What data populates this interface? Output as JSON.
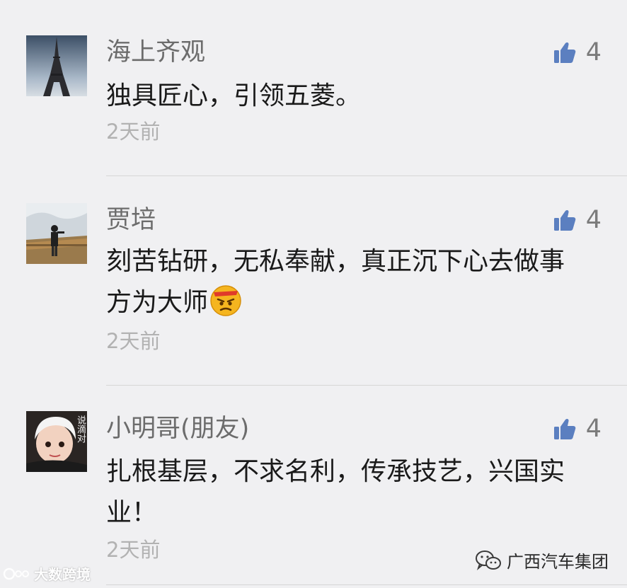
{
  "comments": [
    {
      "name": "海上齐观",
      "likes": "4",
      "text": "独具匠心，引领五菱。",
      "time": "2天前",
      "avatar_icon": "eiffel-tower-photo"
    },
    {
      "name": "贾培",
      "likes": "4",
      "text": "刻苦钻研，无私奉献，真正沉下心去做事方为大师",
      "time": "2天前",
      "avatar_icon": "person-on-boardwalk-photo",
      "emoji": "angry-face-emoji"
    },
    {
      "name": "小明哥(朋友)",
      "likes": "4",
      "text": "扎根基层，不求名利，传承技艺，兴国实业！",
      "time": "2天前",
      "avatar_icon": "child-portrait-photo",
      "avatar_caption": "说滴对"
    }
  ],
  "watermark_left": "大数跨境",
  "watermark_right": "广西汽车集团",
  "colors": {
    "background": "#f0f0f2",
    "like_icon": "#5b7fc0",
    "name": "#6c6c6c",
    "time": "#b2b2b2"
  }
}
